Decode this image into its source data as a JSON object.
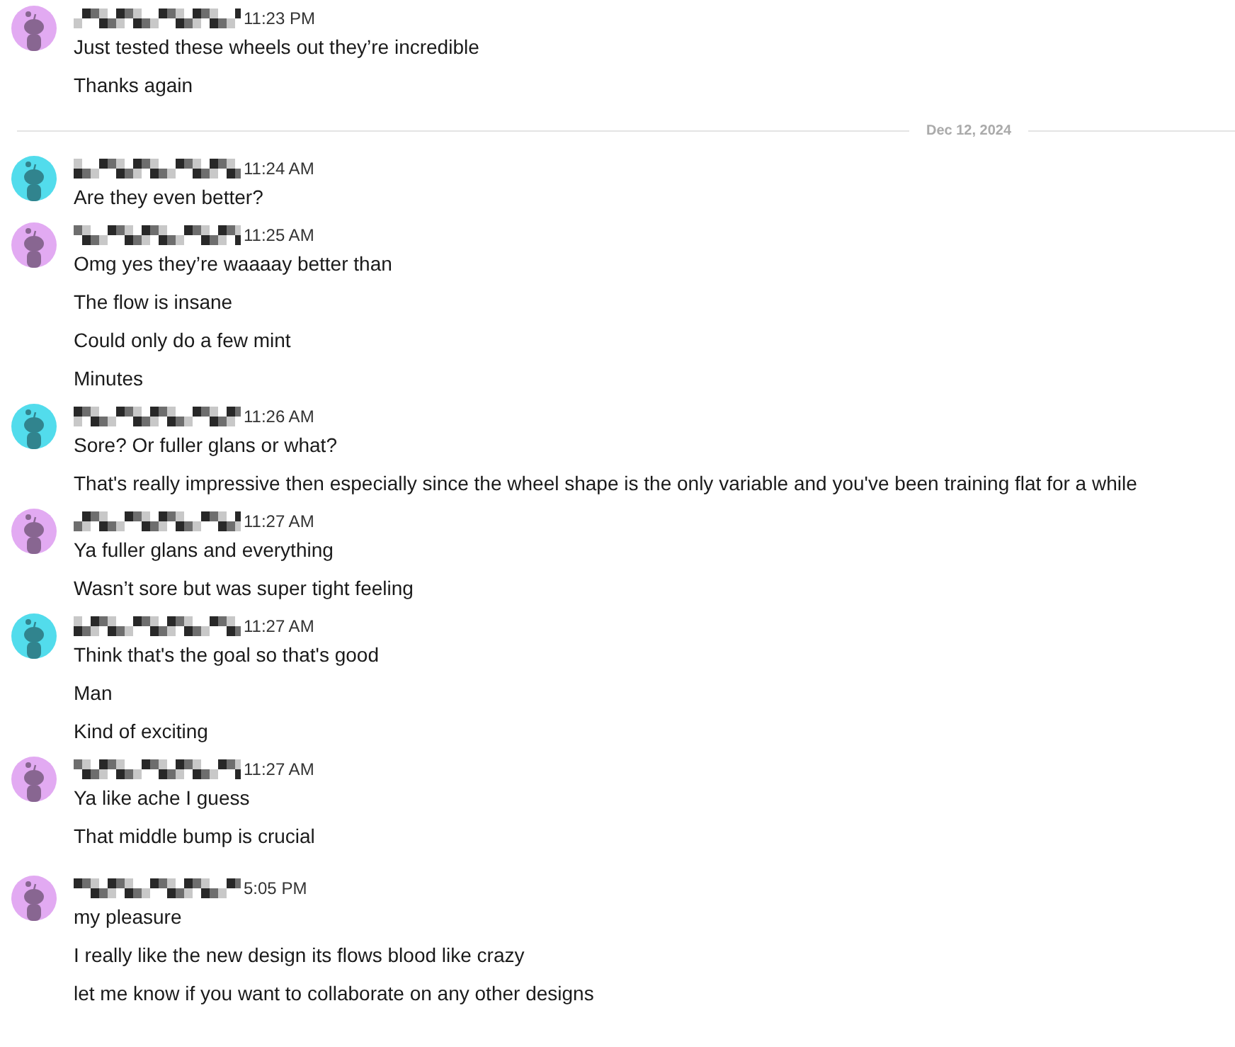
{
  "items": [
    {
      "kind": "group",
      "time": "11:23 PM",
      "color": "#e2aaf2",
      "messages": [
        "Just tested these wheels out they’re incredible",
        "Thanks again"
      ]
    },
    {
      "kind": "divider",
      "label": "Dec 12, 2024"
    },
    {
      "kind": "group",
      "time": "11:24 AM",
      "color": "#52dcec",
      "messages": [
        "Are they even better?"
      ]
    },
    {
      "kind": "group",
      "time": "11:25 AM",
      "color": "#e2aaf2",
      "messages": [
        "Omg yes they’re waaaay better than",
        "The flow is insane",
        "Could only do a few mint",
        "Minutes"
      ]
    },
    {
      "kind": "group",
      "time": "11:26 AM",
      "color": "#52dcec",
      "messages": [
        "Sore? Or fuller glans or what?",
        "That's really impressive then especially since the wheel shape is the only variable and you've been training flat for a while"
      ]
    },
    {
      "kind": "group",
      "time": "11:27 AM",
      "color": "#e2aaf2",
      "messages": [
        "Ya fuller glans and everything",
        "Wasn’t sore but was super tight feeling"
      ]
    },
    {
      "kind": "group",
      "time": "11:27 AM",
      "color": "#52dcec",
      "messages": [
        "Think that's the goal so that's good",
        "Man",
        "Kind of exciting"
      ]
    },
    {
      "kind": "group",
      "time": "11:27 AM",
      "color": "#e2aaf2",
      "messages": [
        "Ya like ache I guess",
        "That middle bump is crucial"
      ]
    },
    {
      "kind": "group",
      "time": "5:05 PM",
      "color": "#e2aaf2",
      "messages": [
        "my pleasure",
        "I really like the new design its flows blood like crazy",
        "let me know if you want to collaborate on any other designs"
      ]
    }
  ]
}
